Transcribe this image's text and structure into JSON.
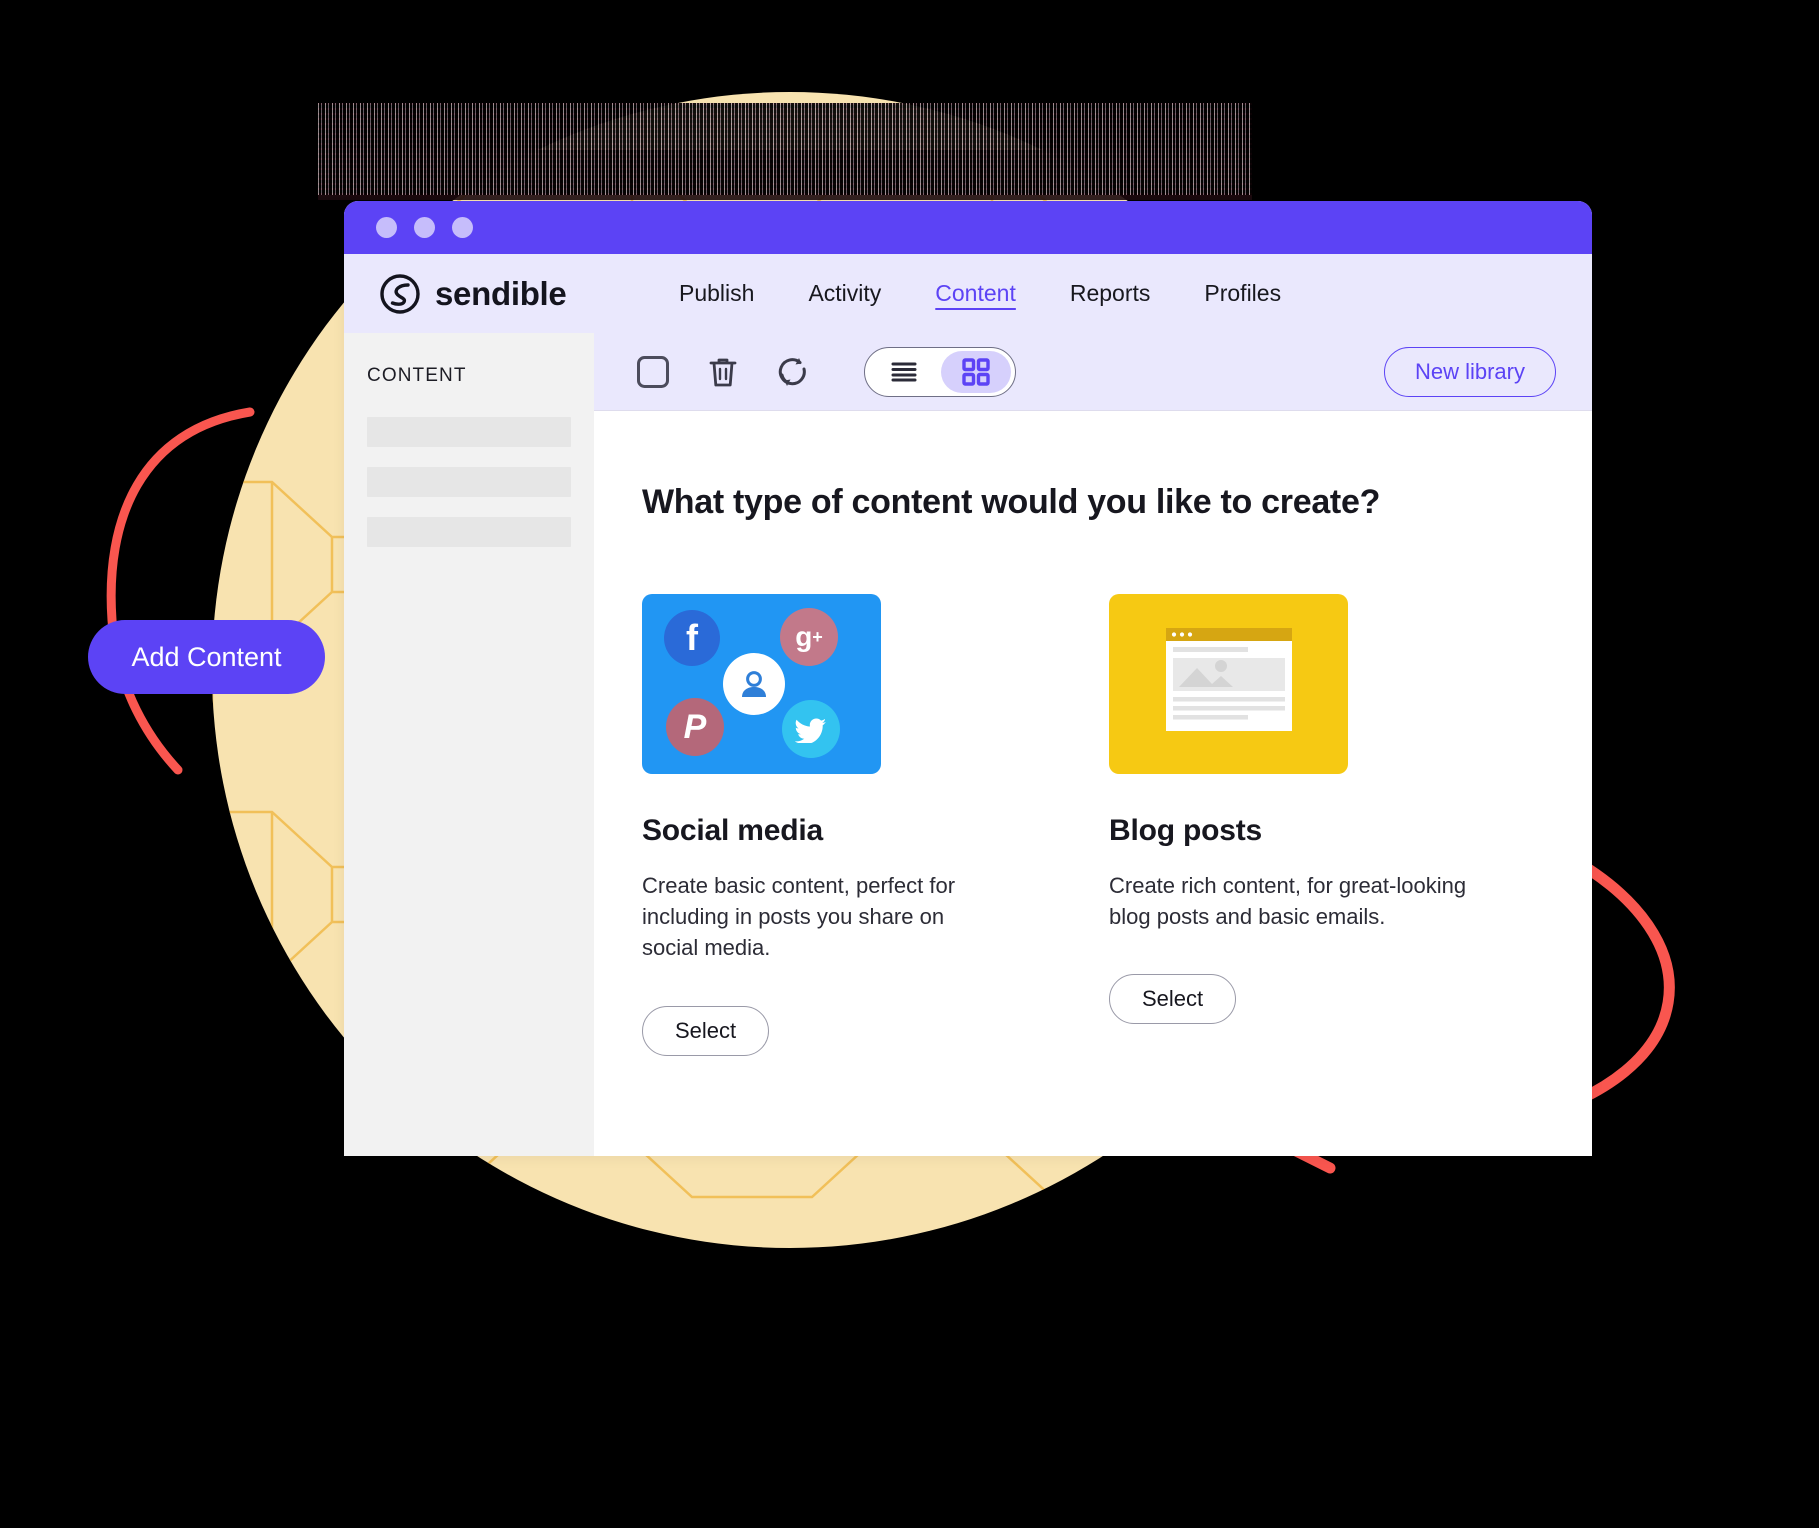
{
  "colors": {
    "brand_purple": "#5c43f5",
    "nav_bg": "#eae8fd",
    "titlebar": "#5c43f5",
    "sidebar_bg": "#f2f2f2",
    "circle_yellow": "#f8e3b0",
    "hex_line": "#f0ba4a",
    "arrow_red": "#f9564f",
    "social_blue": "#2196f3",
    "blog_yellow": "#f6c913"
  },
  "annotation": {
    "pill_label": "Add Content"
  },
  "window": {
    "titlebar": {
      "dots": [
        "dot-1",
        "dot-2",
        "dot-3"
      ]
    },
    "nav": {
      "brand": "sendible",
      "brand_icon": "sendible-logo-icon",
      "links": [
        {
          "label": "Publish",
          "active": false
        },
        {
          "label": "Activity",
          "active": false
        },
        {
          "label": "Content",
          "active": true
        },
        {
          "label": "Reports",
          "active": false
        },
        {
          "label": "Profiles",
          "active": false
        }
      ]
    },
    "sidebar": {
      "title": "CONTENT",
      "placeholder_rows": 3
    },
    "toolbar": {
      "icons": [
        "checkbox-icon",
        "trash-icon",
        "refresh-icon"
      ],
      "view_toggle": {
        "list_icon": "list-view-icon",
        "grid_icon": "grid-view-icon",
        "selected": "grid"
      },
      "new_library_label": "New library"
    },
    "main": {
      "heading": "What type of content would you like to create?",
      "cards": [
        {
          "id": "social-media",
          "title": "Social media",
          "description": "Create basic content, perfect for including in posts you share on social media.",
          "button_label": "Select",
          "thumb_icons": [
            "facebook-icon",
            "google-plus-icon",
            "person-icon",
            "pinterest-icon",
            "twitter-icon"
          ]
        },
        {
          "id": "blog-posts",
          "title": "Blog posts",
          "description": "Create rich content, for great-looking blog posts and basic emails.",
          "button_label": "Select",
          "thumb_icons": [
            "browser-window-icon",
            "image-placeholder-icon"
          ]
        }
      ]
    }
  }
}
